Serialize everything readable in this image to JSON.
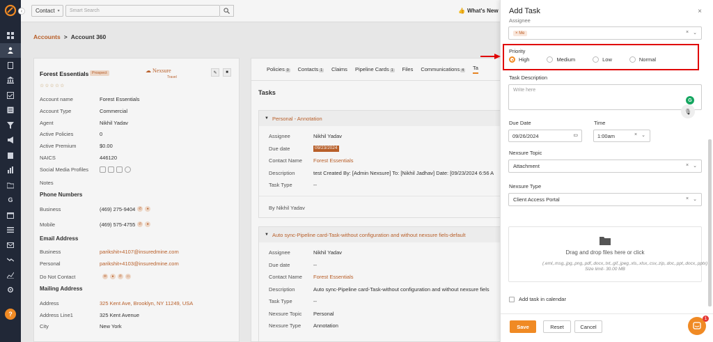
{
  "topbar": {
    "contact_select": "Contact",
    "search_placeholder": "Smart Search",
    "whats_new": "What's New"
  },
  "breadcrumb": {
    "accounts": "Accounts",
    "separator": ">",
    "current": "Account 360"
  },
  "account": {
    "name": "Forest Essentials",
    "status_badge": "Prospect",
    "logo_text": "Nexsure",
    "logo_sub": "Travel",
    "fields": [
      {
        "label": "Account name",
        "value": "Forest Essentials"
      },
      {
        "label": "Account Type",
        "value": "Commercial"
      },
      {
        "label": "Agent",
        "value": "Nikhil Yadav"
      },
      {
        "label": "Active Policies",
        "value": "0"
      },
      {
        "label": "Active Premium",
        "value": "$0.00"
      },
      {
        "label": "NAICS",
        "value": "446120"
      },
      {
        "label": "Social Media Profiles",
        "value": ""
      },
      {
        "label": "Notes",
        "value": ""
      }
    ],
    "phone_section": "Phone Numbers",
    "phones": [
      {
        "label": "Business",
        "value": "(469) 275-9404"
      },
      {
        "label": "Mobile",
        "value": "(469) 575-4755"
      }
    ],
    "email_section": "Email Address",
    "emails": [
      {
        "label": "Business",
        "value": "parikshit+4107@insuredmine.com"
      },
      {
        "label": "Personal",
        "value": "parikshit+4103@insuredmine.com"
      }
    ],
    "dnc_label": "Do Not Contact",
    "mailing_section": "Mailing Address",
    "address": [
      {
        "label": "Address",
        "value": "325 Kent Ave, Brooklyn, NY 11249, USA"
      },
      {
        "label": "Address Line1",
        "value": "325 Kent Avenue"
      },
      {
        "label": "City",
        "value": "New York"
      }
    ]
  },
  "tabs": [
    {
      "label": "Policies",
      "count": "0"
    },
    {
      "label": "Contacts",
      "count": "1"
    },
    {
      "label": "Claims",
      "count": ""
    },
    {
      "label": "Pipeline Cards",
      "count": "1"
    },
    {
      "label": "Files",
      "count": ""
    },
    {
      "label": "Communications",
      "count": "4"
    },
    {
      "label": "Ta",
      "count": ""
    }
  ],
  "tasks": {
    "title": "Tasks",
    "task1": {
      "heading": "Personal - Annotation",
      "rows": [
        {
          "k": "Assignee",
          "v": "Nikhil Yadav"
        },
        {
          "k": "Due date",
          "v": "09/23/2024"
        },
        {
          "k": "Contact Name",
          "v": "Forest Essentials"
        },
        {
          "k": "Description",
          "v": "test Created By: [Admin Nexsure] To: [Nikhil Jadhav]  Date: [09/23/2024 6:56 A"
        },
        {
          "k": "Task Type",
          "v": "--"
        }
      ],
      "by": "By Nikhil Yadav"
    },
    "task2": {
      "heading": "Auto sync-Pipeline card-Task-without configuration and without nexsure fiels-default",
      "rows": [
        {
          "k": "Assignee",
          "v": "Nikhil Yadav"
        },
        {
          "k": "Due date",
          "v": "--"
        },
        {
          "k": "Contact Name",
          "v": "Forest Essentials"
        },
        {
          "k": "Description",
          "v": "Auto sync-Pipeline card-Task-without configuration and  without nexsure fiels"
        },
        {
          "k": "Task Type",
          "v": "--"
        },
        {
          "k": "Nexsure Topic",
          "v": "Personal"
        },
        {
          "k": "Nexsure Type",
          "v": "Annotation"
        }
      ]
    }
  },
  "modal": {
    "title": "Add Task",
    "close": "×",
    "assignee_label": "Assignee",
    "assignee_chip": "Me",
    "priority_label": "Priority",
    "priority_options": [
      "High",
      "Medium",
      "Low",
      "Normal"
    ],
    "priority_selected": "High",
    "description_label": "Task Description",
    "description_placeholder": "Write here",
    "due_date_label": "Due Date",
    "due_date_value": "09/26/2024",
    "time_label": "Time",
    "time_value": "1:00am",
    "topic_label": "Nexsure Topic",
    "topic_value": "Attachment",
    "type_label": "Nexsure Type",
    "type_value": "Client Access Portal",
    "dropzone_text": "Drag and drop files here or click",
    "dropzone_sub": "(.eml,.msg,.jpg,.png,.pdf,.docx,.txt,.gif,.jpeg,.xls,.xlsx,.csv,.zip,.doc,.ppt,.docx,.pptx) Size limit- 30.00 MB",
    "calendar_label": "Add task in calendar",
    "save": "Save",
    "reset": "Reset",
    "cancel": "Cancel"
  },
  "chat_badge": "1",
  "sidebar_bottom": "?",
  "colors": {
    "accent": "#f08a24",
    "link": "#c0632b",
    "sidebar": "#212837",
    "highlight": "#e00000"
  }
}
